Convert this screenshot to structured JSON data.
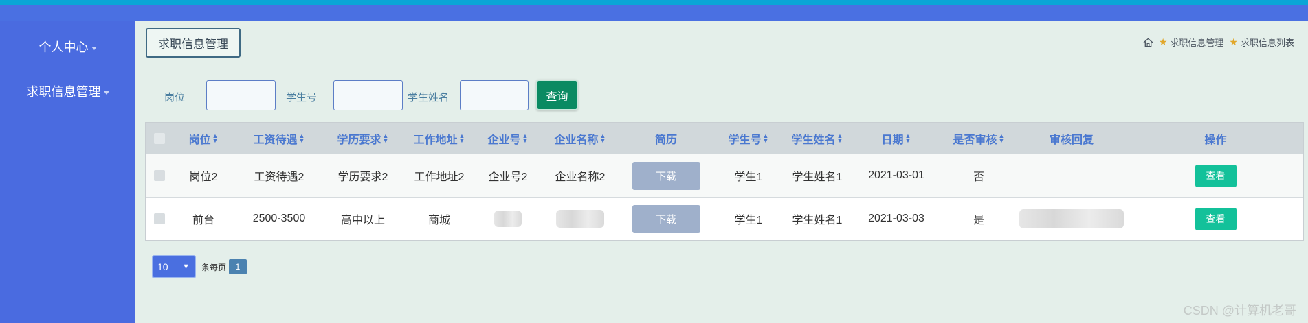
{
  "sidebar": {
    "items": [
      {
        "label": "个人中心"
      },
      {
        "label": "求职信息管理"
      }
    ]
  },
  "page": {
    "title": "求职信息管理",
    "breadcrumb": [
      "求职信息管理",
      "求职信息列表"
    ]
  },
  "search": {
    "fields": [
      {
        "label": "岗位",
        "value": ""
      },
      {
        "label": "学生号",
        "value": ""
      },
      {
        "label": "学生姓名",
        "value": ""
      }
    ],
    "query_label": "查询"
  },
  "table": {
    "headers": [
      "岗位",
      "工资待遇",
      "学历要求",
      "工作地址",
      "企业号",
      "企业名称",
      "简历",
      "学生号",
      "学生姓名",
      "日期",
      "是否审核",
      "审核回复",
      "操作"
    ],
    "rows": [
      {
        "position": "岗位2",
        "salary": "工资待遇2",
        "education": "学历要求2",
        "address": "工作地址2",
        "company_no": "企业号2",
        "company_name": "企业名称2",
        "resume": "下载",
        "student_no": "学生1",
        "student_name": "学生姓名1",
        "date": "2021-03-01",
        "audited": "否",
        "reply": "",
        "action": "查看"
      },
      {
        "position": "前台",
        "salary": "2500-3500",
        "education": "高中以上",
        "address": "商城",
        "company_no": "",
        "company_name": "",
        "resume": "下载",
        "student_no": "学生1",
        "student_name": "学生姓名1",
        "date": "2021-03-03",
        "audited": "是",
        "reply": "",
        "action": "查看"
      }
    ]
  },
  "pagination": {
    "page_size": "10",
    "per_page_label": "条每页",
    "current_page": "1"
  },
  "watermark": "CSDN @计算机老哥",
  "colors": {
    "topbar": "#4a70e2",
    "topbar_strip": "#0aa6d6",
    "sidebar": "#4a6be0",
    "content_bg": "#e4efea",
    "query_button": "#0a8a62",
    "view_button": "#13c19a",
    "download_button": "#9fb0cb"
  }
}
